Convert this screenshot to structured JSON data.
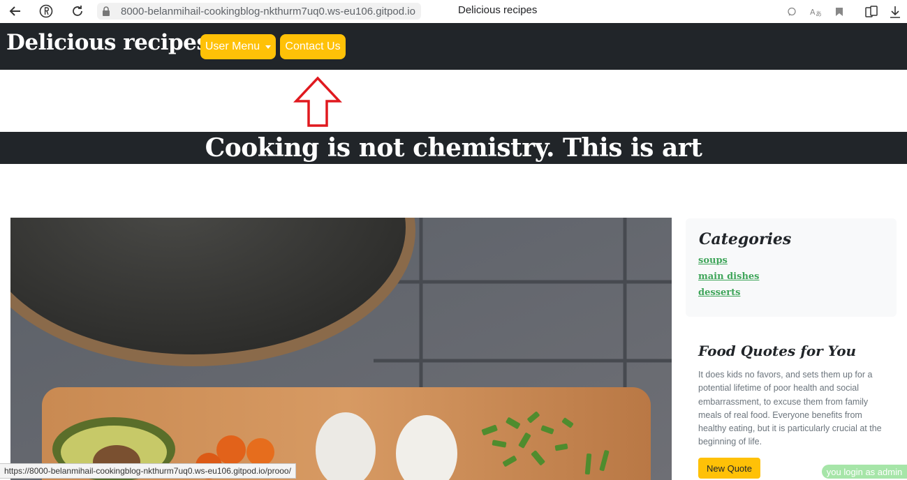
{
  "browser": {
    "url": "8000-belanmihail-cookingblog-nkthurm7uq0.ws-eu106.gitpod.io",
    "tab_title": "Delicious recipes",
    "status_url": "https://8000-belanmihail-cookingblog-nkthurm7uq0.ws-eu106.gitpod.io/prooo/"
  },
  "navbar": {
    "brand": "Delicious recipes",
    "user_menu_label": "User Menu",
    "contact_label": "Contact Us"
  },
  "hero": {
    "text": "Cooking is not chemistry. This is art"
  },
  "sidebar": {
    "categories_title": "Categories",
    "categories": [
      {
        "label": "soups"
      },
      {
        "label": "main dishes"
      },
      {
        "label": "desserts"
      }
    ],
    "quotes_title": "Food Quotes for You",
    "quote_text": "It does kids no favors, and sets them up for a potential lifetime of poor health and social embarrassment, to excuse them from family meals of real food. Everyone benefits from healthy eating, but it is particularly crucial at the beginning of life.",
    "new_quote_label": "New Quote"
  },
  "login_status": "you login as admin",
  "colors": {
    "navbar_bg": "#212529",
    "accent_yellow": "#ffc107",
    "link_green": "#3fa55a",
    "annotation_red": "#e0191f"
  }
}
